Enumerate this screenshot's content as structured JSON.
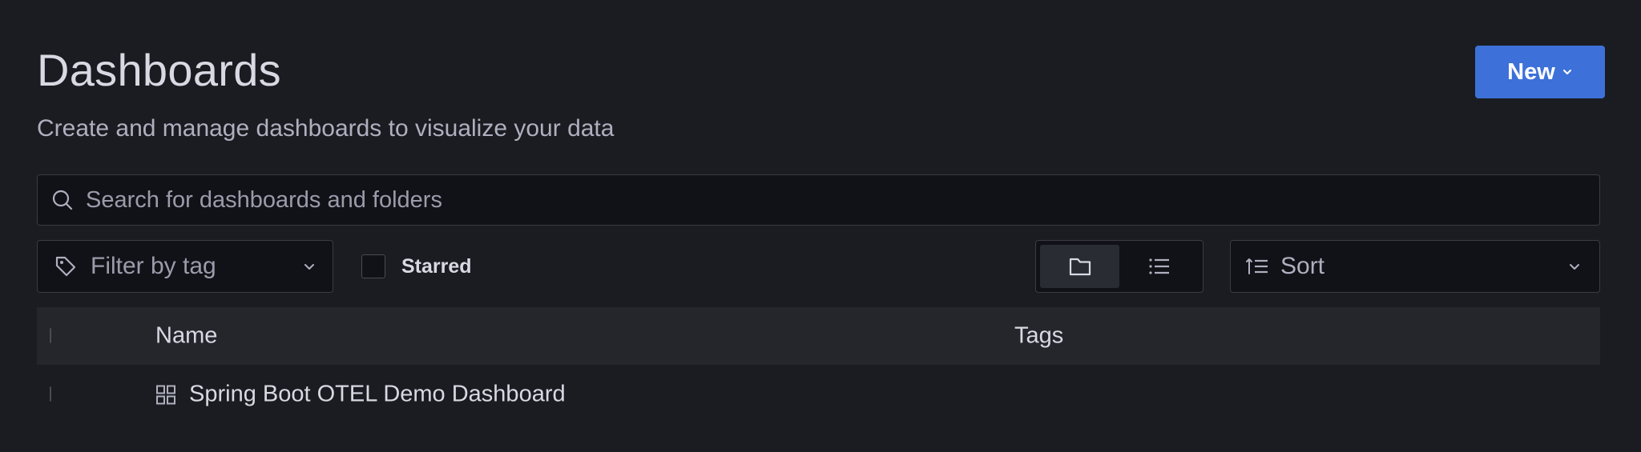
{
  "header": {
    "title": "Dashboards",
    "subtitle": "Create and manage dashboards to visualize your data",
    "new_button_label": "New"
  },
  "search": {
    "placeholder": "Search for dashboards and folders",
    "value": ""
  },
  "filters": {
    "tag_filter_placeholder": "Filter by tag",
    "starred_label": "Starred",
    "starred_checked": false,
    "view_mode": "folder",
    "sort_placeholder": "Sort"
  },
  "table": {
    "columns": [
      "Name",
      "Tags"
    ],
    "rows": [
      {
        "name": "Spring Boot OTEL Demo Dashboard",
        "tags": []
      }
    ]
  },
  "colors": {
    "background": "#1b1c21",
    "primary_button": "#3d71d9",
    "header_row": "#25262c"
  },
  "icons": {
    "search": "search-icon",
    "tag": "tag-icon",
    "chevron": "chevron-down-icon",
    "folder_view": "folder-icon",
    "list_view": "list-icon",
    "sort": "sort-ascending-icon",
    "dashboard": "dashboard-grid-icon"
  }
}
